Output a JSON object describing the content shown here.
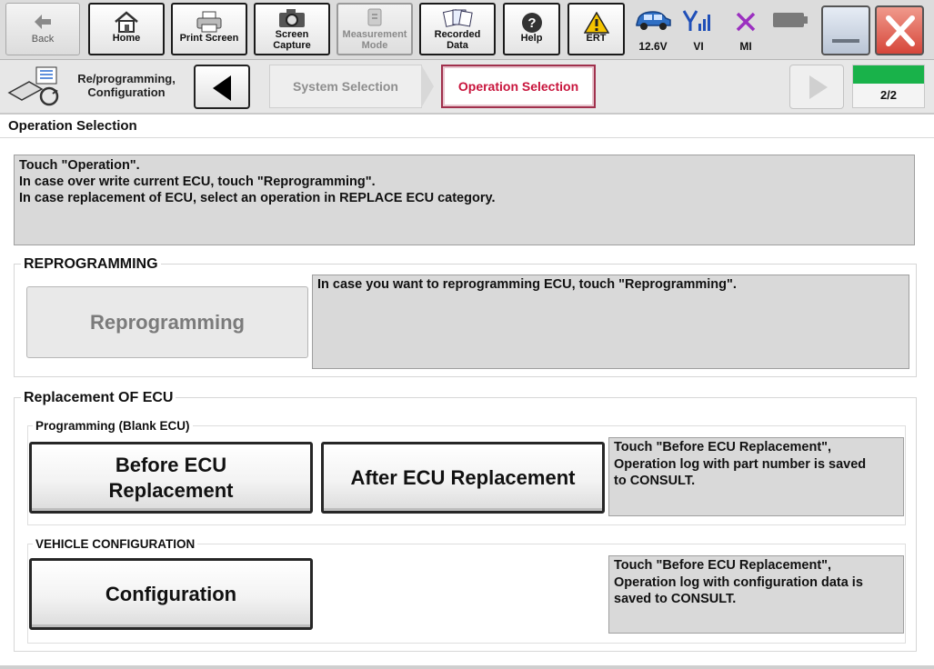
{
  "toolbar": {
    "back_label": "Back",
    "home_label": "Home",
    "print_label": "Print Screen",
    "capture_label": "Screen\nCapture",
    "measurement_label": "Measurement\nMode",
    "recorded_label": "Recorded\nData",
    "help_label": "Help",
    "ert_label": "ERT",
    "voltage_label": "12.6V",
    "vi_label": "VI",
    "mi_label": "MI"
  },
  "breadcrumb": {
    "title": "Re/programming,\nConfiguration",
    "steps": [
      "System Selection",
      "Operation Selection"
    ],
    "active_step": "Operation Selection",
    "page_counter": "2/2",
    "progress": 1.0
  },
  "page": {
    "title": "Operation Selection",
    "instructions": "Touch \"Operation\".\nIn case over write current ECU, touch \"Reprogramming\".\nIn case replacement of ECU, select an operation in REPLACE ECU category."
  },
  "reprogramming": {
    "section_title": "REPROGRAMMING",
    "button_label": "Reprogramming",
    "description": "In case you want to reprogramming ECU, touch \"Reprogramming\"."
  },
  "replacement": {
    "section_title": "Replacement OF ECU",
    "programming": {
      "title": "Programming (Blank ECU)",
      "before_label": "Before ECU\nReplacement",
      "after_label": "After ECU Replacement",
      "description": "Touch \"Before ECU Replacement\",\nOperation log with part number is saved\nto CONSULT."
    },
    "vehicle_config": {
      "title": "VEHICLE CONFIGURATION",
      "button_label": "Configuration",
      "description": "Touch \"Before ECU Replacement\",\nOperation log with configuration data is\nsaved to CONSULT."
    }
  },
  "colors": {
    "active_step": "#c8143c",
    "progress_fill": "#19b24a",
    "close_button": "#d6463a",
    "ert_warning": "#f5c400",
    "mi_mark": "#9b30c0",
    "vi_mark": "#1f4fb8"
  }
}
